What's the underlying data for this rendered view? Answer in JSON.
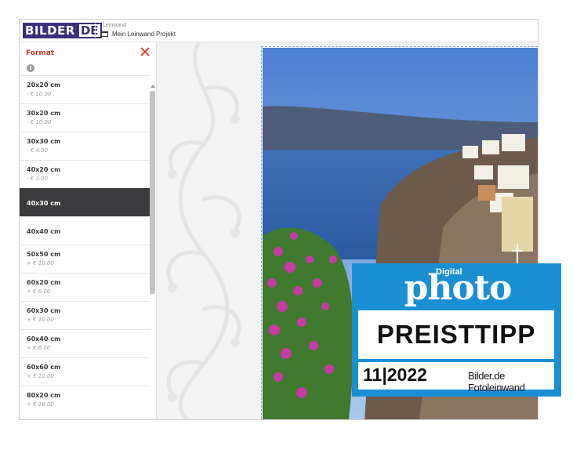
{
  "header": {
    "logo_part1": "BILDER",
    "logo_part2": "DE",
    "breadcrumb_parent": "Leinwand",
    "project_name": "Mein Leinwand Projekt",
    "brand_color": "#3a2f7a"
  },
  "sidebar": {
    "title": "Format",
    "close_icon": "close-icon",
    "info_icon": "info-icon",
    "info_glyph": "i",
    "accent_color": "#c0392b",
    "selected_color": "#3b3b3d",
    "items": [
      {
        "size": "20x20 cm",
        "price": "- € 10.00"
      },
      {
        "size": "30x20 cm",
        "price": "- € 10.00"
      },
      {
        "size": "30x30 cm",
        "price": "- € 4.00"
      },
      {
        "size": "40x20 cm",
        "price": "- € 2.00"
      },
      {
        "size": "40x30 cm",
        "price": ""
      },
      {
        "size": "40x40 cm",
        "price": ""
      },
      {
        "size": "50x50 cm",
        "price": "+ € 10.00"
      },
      {
        "size": "60x20 cm",
        "price": "+ € 6.00"
      },
      {
        "size": "60x30 cm",
        "price": "+ € 10.00"
      },
      {
        "size": "60x40 cm",
        "price": "+ € 6.00"
      },
      {
        "size": "60x60 cm",
        "price": "+ € 10.00"
      },
      {
        "size": "80x20 cm",
        "price": "+ € 18.00"
      }
    ],
    "selected": "40x30 cm"
  },
  "badge": {
    "digital": "Digital",
    "photo": "photo",
    "headline": "PREISTTIPP",
    "issue": "11|2022",
    "source": "Bilder.de Fotoleinwand",
    "color": "#1a8fd4"
  }
}
